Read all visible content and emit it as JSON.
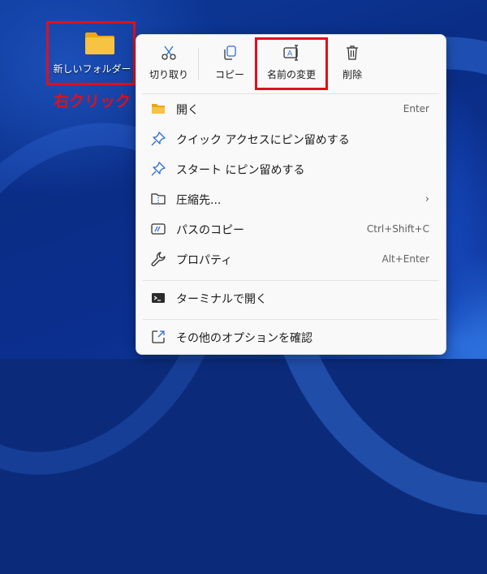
{
  "desktop": {
    "folder": {
      "label": "新しいフォルダー"
    },
    "annotation": {
      "right_click": "右クリック"
    }
  },
  "context_menu": {
    "toolbar": [
      {
        "id": "cut",
        "label": "切り取り",
        "icon": "scissors-icon"
      },
      {
        "id": "copy",
        "label": "コピー",
        "icon": "copy-icon"
      },
      {
        "id": "rename",
        "label": "名前の変更",
        "icon": "rename-icon"
      },
      {
        "id": "delete",
        "label": "削除",
        "icon": "trash-icon"
      }
    ],
    "items": [
      {
        "label": "開く",
        "shortcut": "Enter",
        "icon": "folder-open-icon"
      },
      {
        "label": "クイック アクセスにピン留めする",
        "shortcut": "",
        "icon": "pin-icon"
      },
      {
        "label": "スタート にピン留めする",
        "shortcut": "",
        "icon": "pin-icon"
      },
      {
        "label": "圧縮先...",
        "shortcut": "",
        "icon": "zip-folder-icon",
        "submenu": "›"
      },
      {
        "label": "パスのコピー",
        "shortcut": "Ctrl+Shift+C",
        "icon": "copy-path-icon"
      },
      {
        "label": "プロパティ",
        "shortcut": "Alt+Enter",
        "icon": "wrench-icon"
      },
      {
        "label": "ターミナルで開く",
        "shortcut": "",
        "icon": "terminal-icon"
      },
      {
        "label": "その他のオプションを確認",
        "shortcut": "",
        "icon": "more-options-icon"
      }
    ]
  },
  "colors": {
    "highlight_box": "#e0101a",
    "menu_background": "#f9f9f9",
    "icon_accent": "#2b6fd6",
    "folder_yellow": "#f6c343"
  }
}
